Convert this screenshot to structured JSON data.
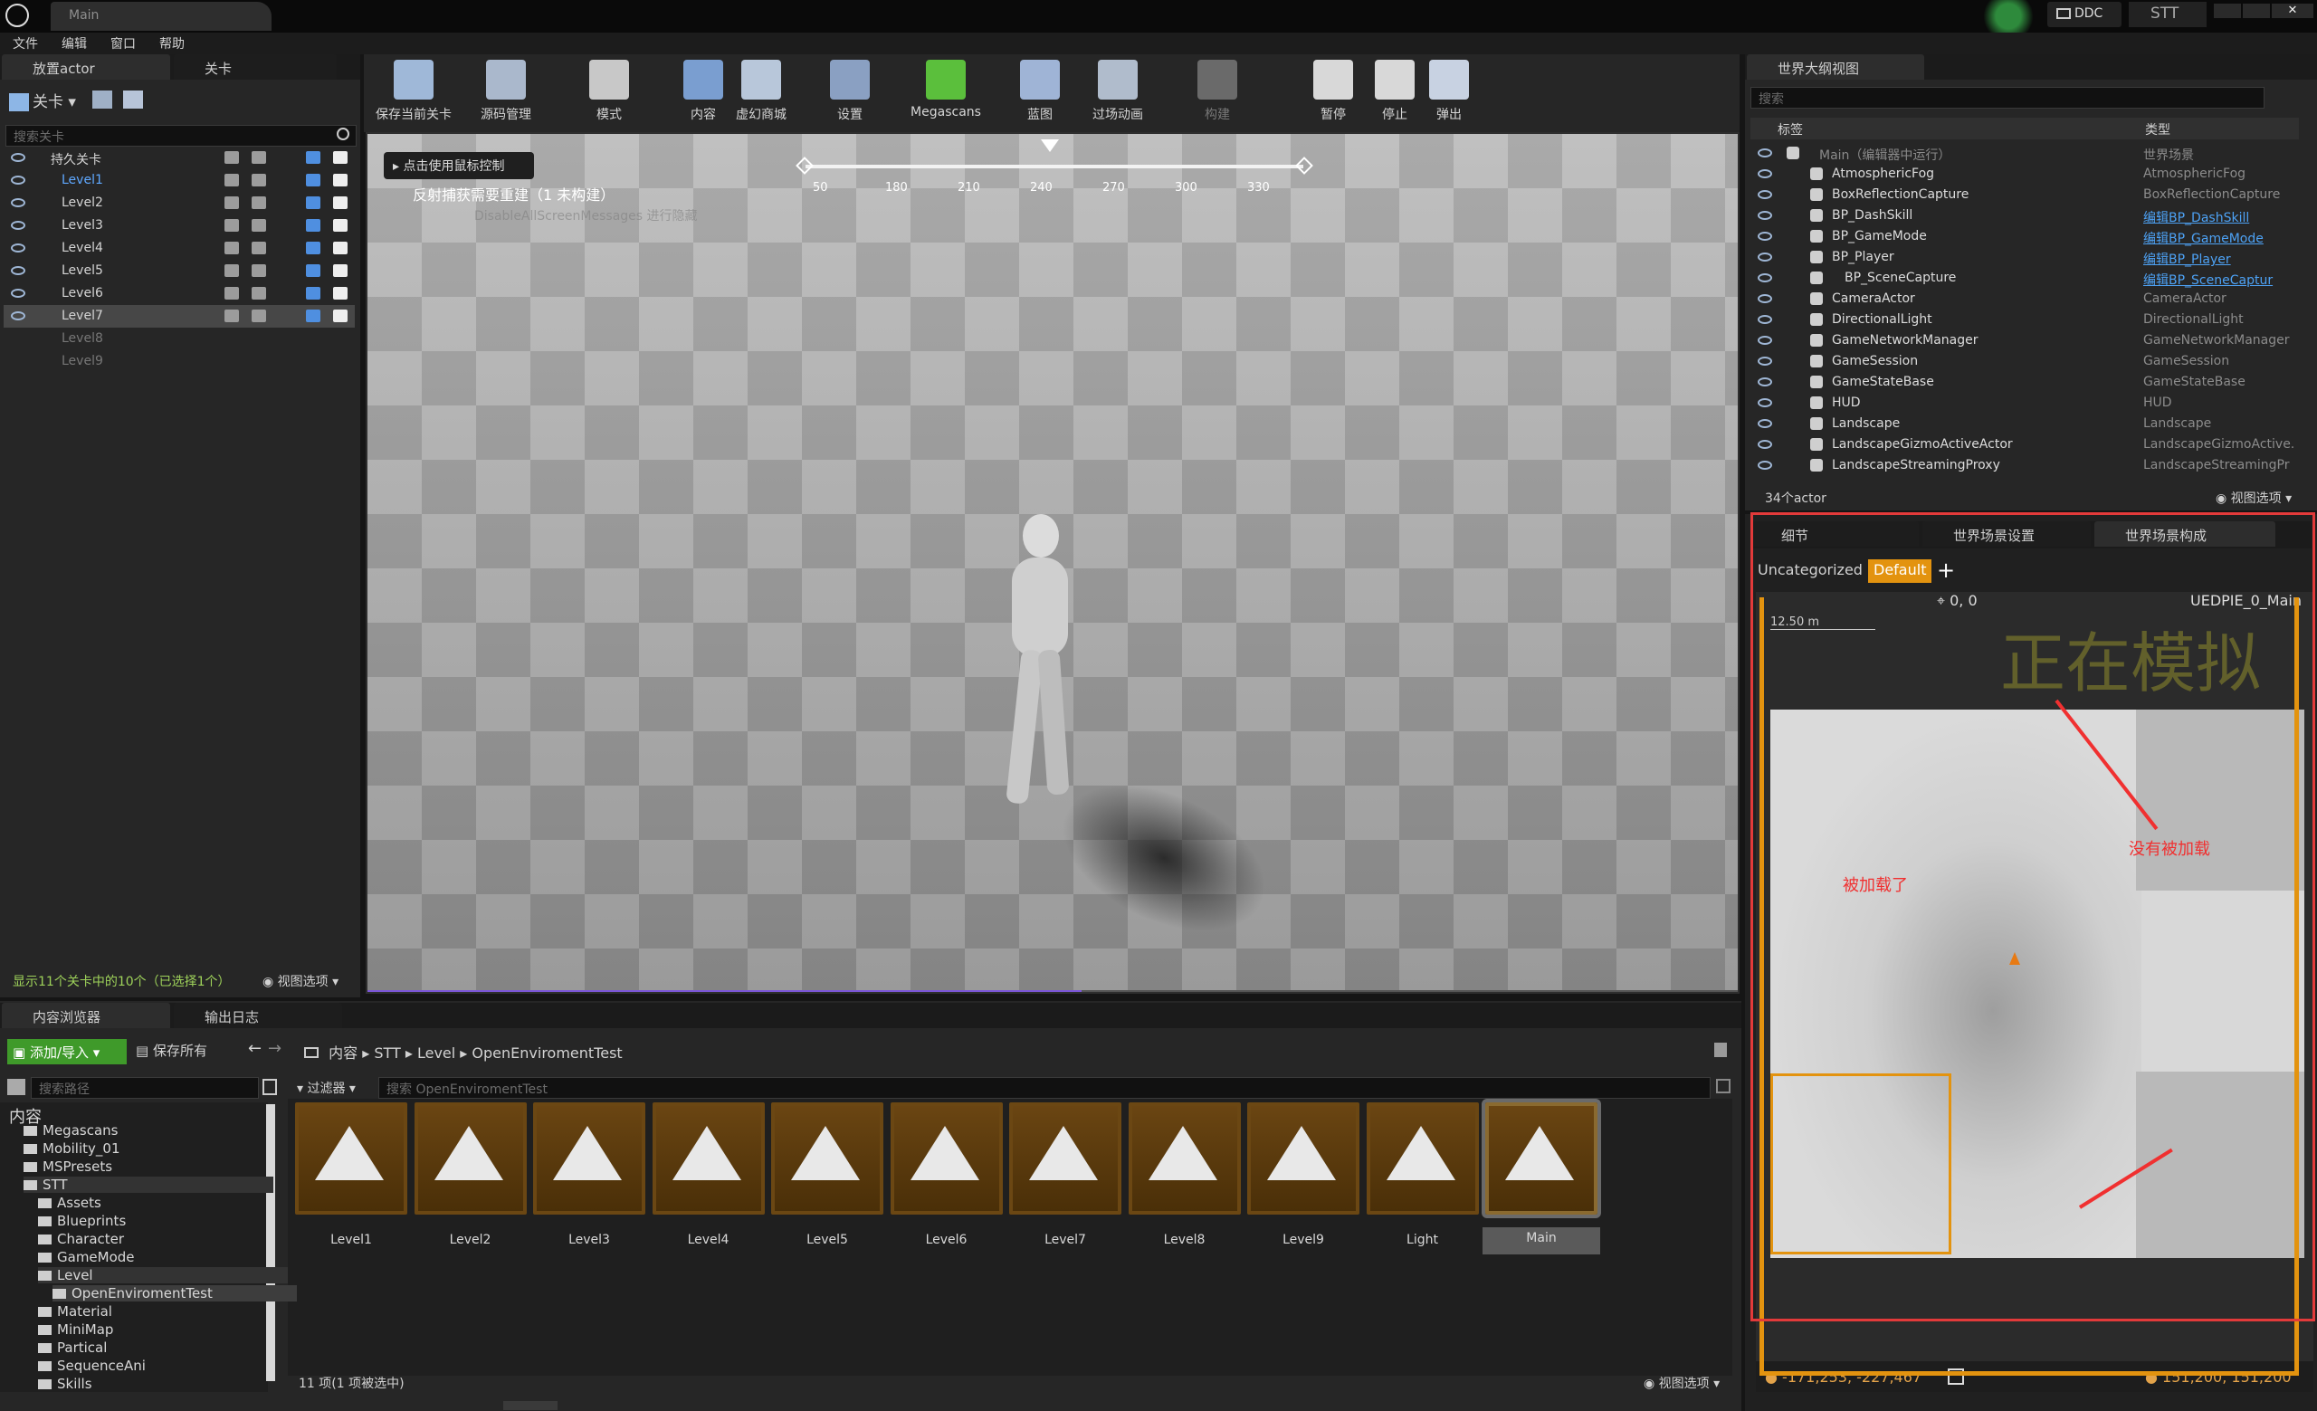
{
  "window": {
    "tab_title": "Main",
    "ddc_label": "DDC",
    "stt_label": "STT"
  },
  "menu": [
    "文件",
    "编辑",
    "窗口",
    "帮助"
  ],
  "left_tabs": {
    "place_actor": "放置actor",
    "levels": "关卡"
  },
  "levels_panel": {
    "toolbar_label": "关卡",
    "search_placeholder": "搜索关卡",
    "items": [
      {
        "name": "持久关卡",
        "style": "persistent"
      },
      {
        "name": "Level1",
        "style": "active"
      },
      {
        "name": "Level2",
        "style": "normal"
      },
      {
        "name": "Level3",
        "style": "normal"
      },
      {
        "name": "Level4",
        "style": "normal"
      },
      {
        "name": "Level5",
        "style": "normal"
      },
      {
        "name": "Level6",
        "style": "normal"
      },
      {
        "name": "Level7",
        "style": "selected"
      },
      {
        "name": "Level8",
        "style": "unloaded"
      },
      {
        "name": "Level9",
        "style": "unloaded"
      }
    ],
    "status": "显示11个关卡中的10个（已选择1个）",
    "view_options": "视图选项"
  },
  "toolbar": [
    {
      "label": "保存当前关卡",
      "icon": "save-icon"
    },
    {
      "label": "源码管理",
      "icon": "source-control-icon"
    },
    {
      "label": "模式",
      "icon": "modes-icon"
    },
    {
      "label": "内容",
      "icon": "content-icon"
    },
    {
      "label": "虚幻商城",
      "icon": "marketplace-icon"
    },
    {
      "label": "设置",
      "icon": "settings-icon"
    },
    {
      "label": "Megascans",
      "icon": "megascans-icon"
    },
    {
      "label": "蓝图",
      "icon": "blueprint-icon"
    },
    {
      "label": "过场动画",
      "icon": "cinematics-icon"
    },
    {
      "label": "构建",
      "icon": "build-icon"
    },
    {
      "label": "暂停",
      "icon": "pause-icon"
    },
    {
      "label": "停止",
      "icon": "stop-icon"
    },
    {
      "label": "弹出",
      "icon": "eject-icon"
    }
  ],
  "viewport": {
    "mouse_hint": "点击使用鼠标控制",
    "reflection_msg": "反射捕获需要重建（1 未构建）",
    "faded_msg": "DisableAllScreenMessages 进行隐藏",
    "compass_ticks": [
      "50",
      "180",
      "210",
      "240",
      "270",
      "300",
      "330"
    ]
  },
  "outliner": {
    "tab": "世界大纲视图",
    "search_placeholder": "搜索",
    "col_label": "标签",
    "col_type": "类型",
    "rows": [
      {
        "name": "Main（编辑器中运行）",
        "type": "世界场景",
        "link": false
      },
      {
        "name": "AtmosphericFog",
        "type": "AtmosphericFog",
        "link": false
      },
      {
        "name": "BoxReflectionCapture",
        "type": "BoxReflectionCapture",
        "link": false
      },
      {
        "name": "BP_DashSkill",
        "type": "编辑BP_DashSkill",
        "link": true
      },
      {
        "name": "BP_GameMode",
        "type": "编辑BP_GameMode",
        "link": true
      },
      {
        "name": "BP_Player",
        "type": "编辑BP_Player",
        "link": true
      },
      {
        "name": "BP_SceneCapture",
        "type": "编辑BP_SceneCaptur",
        "link": true
      },
      {
        "name": "CameraActor",
        "type": "CameraActor",
        "link": false
      },
      {
        "name": "DirectionalLight",
        "type": "DirectionalLight",
        "link": false
      },
      {
        "name": "GameNetworkManager",
        "type": "GameNetworkManager",
        "link": false
      },
      {
        "name": "GameSession",
        "type": "GameSession",
        "link": false
      },
      {
        "name": "GameStateBase",
        "type": "GameStateBase",
        "link": false
      },
      {
        "name": "HUD",
        "type": "HUD",
        "link": false
      },
      {
        "name": "Landscape",
        "type": "Landscape",
        "link": false
      },
      {
        "name": "LandscapeGizmoActiveActor",
        "type": "LandscapeGizmoActive.",
        "link": false
      },
      {
        "name": "LandscapeStreamingProxy",
        "type": "LandscapeStreamingPr",
        "link": false
      }
    ],
    "count": "34个actor",
    "view_options": "视图选项"
  },
  "world_comp": {
    "tabs": [
      "细节",
      "世界场景设置",
      "世界场景构成"
    ],
    "uncategorized": "Uncategorized",
    "default": "Default",
    "coords_top": "0, 0",
    "world_name": "UEDPIE_0_Main",
    "scale": "12.50 m",
    "simulating": "正在模拟",
    "note_unloaded": "没有被加载",
    "note_loaded": "被加载了",
    "coords_left": "-171,253, -227,467",
    "coords_right": "151,200, 151,200"
  },
  "content_browser": {
    "tab": "内容浏览器",
    "output_tab": "输出日志",
    "add_import": "添加/导入",
    "save_all": "保存所有",
    "breadcrumb": [
      "内容",
      "STT",
      "Level",
      "OpenEnviromentTest"
    ],
    "path_search": "搜索路径",
    "filter": "过滤器",
    "asset_search": "搜索 OpenEnviromentTest",
    "tree": [
      {
        "name": "内容",
        "level": 0
      },
      {
        "name": "Megascans",
        "level": 1
      },
      {
        "name": "Mobility_01",
        "level": 1
      },
      {
        "name": "MSPresets",
        "level": 1
      },
      {
        "name": "STT",
        "level": 1
      },
      {
        "name": "Assets",
        "level": 2
      },
      {
        "name": "Blueprints",
        "level": 2
      },
      {
        "name": "Character",
        "level": 2
      },
      {
        "name": "GameMode",
        "level": 2
      },
      {
        "name": "Level",
        "level": 2
      },
      {
        "name": "OpenEnviromentTest",
        "level": 3
      },
      {
        "name": "Material",
        "level": 2
      },
      {
        "name": "MiniMap",
        "level": 2
      },
      {
        "name": "Partical",
        "level": 2
      },
      {
        "name": "SequenceAni",
        "level": 2
      },
      {
        "name": "Skills",
        "level": 2
      }
    ],
    "assets": [
      "Level1",
      "Level2",
      "Level3",
      "Level4",
      "Level5",
      "Level6",
      "Level7",
      "Level8",
      "Level9",
      "Light",
      "Main"
    ],
    "item_count": "11 项(1 项被选中)",
    "view_options": "视图选项"
  }
}
